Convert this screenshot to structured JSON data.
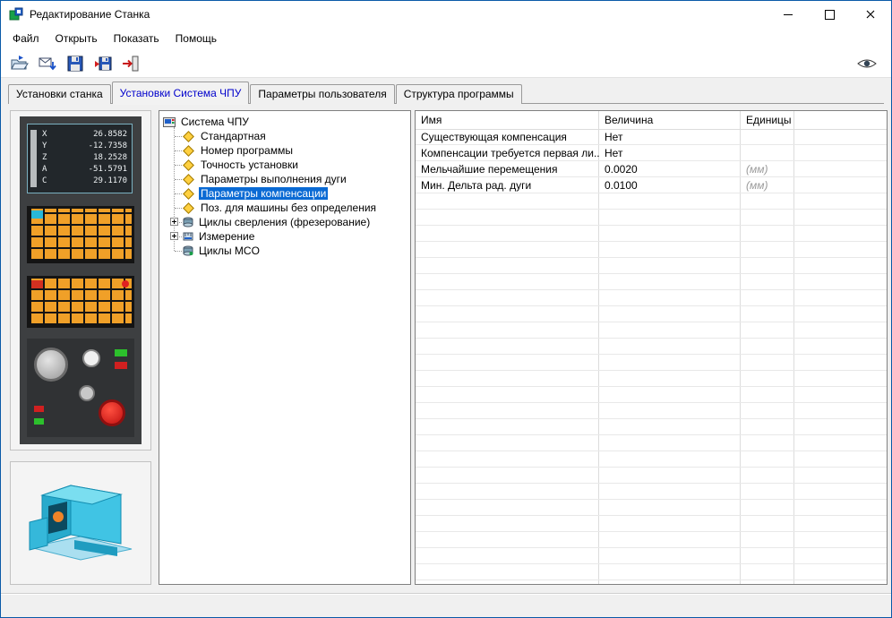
{
  "window": {
    "title": "Редактирование Станка"
  },
  "menu": {
    "items": [
      {
        "label": "Файл"
      },
      {
        "label": "Открыть"
      },
      {
        "label": "Показать"
      },
      {
        "label": "Помощь"
      }
    ]
  },
  "toolbar": {
    "icons": [
      "open",
      "import-mail",
      "save",
      "save-export",
      "exit",
      "view-eye"
    ]
  },
  "tabs": {
    "items": [
      {
        "label": "Установки станка",
        "active": false
      },
      {
        "label": "Установки Система ЧПУ",
        "active": true
      },
      {
        "label": "Параметры пользователя",
        "active": false
      },
      {
        "label": "Структура программы",
        "active": false
      }
    ]
  },
  "control_display": {
    "axes": [
      {
        "label": "X",
        "value": "26.8582"
      },
      {
        "label": "Y",
        "value": "-12.7358"
      },
      {
        "label": "Z",
        "value": "18.2528"
      },
      {
        "label": "A",
        "value": "-51.5791"
      },
      {
        "label": "C",
        "value": "29.1170"
      }
    ]
  },
  "tree": {
    "root_label": "Система ЧПУ",
    "items": [
      {
        "label": "Стандартная",
        "selected": false
      },
      {
        "label": "Номер программы",
        "selected": false
      },
      {
        "label": "Точность установки",
        "selected": false
      },
      {
        "label": "Параметры выполнения дуги",
        "selected": false
      },
      {
        "label": "Параметры компенсации",
        "selected": true
      },
      {
        "label": "Поз. для машины без определения",
        "selected": false
      },
      {
        "label": "Циклы сверления (фрезерование)",
        "expandable": true
      },
      {
        "label": "Измерение",
        "expandable": true
      },
      {
        "label": "Циклы MCO",
        "expandable": false
      }
    ]
  },
  "table": {
    "columns": [
      {
        "label": "Имя"
      },
      {
        "label": "Величина"
      },
      {
        "label": "Единицы"
      }
    ],
    "rows": [
      {
        "name": "Существующая компенсация",
        "value": "Нет",
        "unit": ""
      },
      {
        "name": "Компенсации требуется первая ли...",
        "value": "Нет",
        "unit": ""
      },
      {
        "name": "Мельчайшие перемещения",
        "value": "0.0020",
        "unit": "(мм)"
      },
      {
        "name": "Мин. Дельта рад. дуги",
        "value": "0.0100",
        "unit": "(мм)"
      }
    ]
  },
  "colors": {
    "window_border": "#0a5aa8",
    "selection_bg": "#0a6ad4",
    "selection_text": "#ffffff",
    "active_tab_text": "#0000cc",
    "unit_text": "#9a9a9a",
    "keypad_orange": "#f0a028",
    "machine_cyan": "#38bede"
  }
}
